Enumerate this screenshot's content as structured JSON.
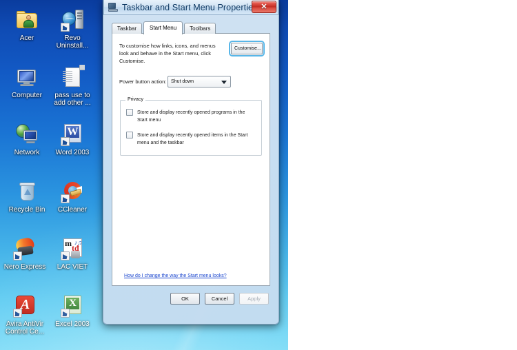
{
  "window": {
    "title": "Taskbar and Start Menu Properties",
    "title_icon": "taskbar-icon",
    "close_label": "✕"
  },
  "tabs": [
    {
      "label": "Taskbar",
      "active": false
    },
    {
      "label": "Start Menu",
      "active": true
    },
    {
      "label": "Toolbars",
      "active": false
    }
  ],
  "start_menu_tab": {
    "description": "To customise how links, icons, and menus look and behave in the Start menu, click Customise.",
    "customise_button": "Customise...",
    "power_button_label": "Power button action:",
    "power_button_value": "Shut down",
    "power_button_options": [
      "Shut down"
    ],
    "privacy": {
      "legend": "Privacy",
      "checkboxes": [
        {
          "label": "Store and display recently opened programs in the Start menu",
          "checked": false
        },
        {
          "label": "Store and display recently opened items in the Start menu and the taskbar",
          "checked": false
        }
      ]
    },
    "help_link": "How do I change the way the Start menu looks?"
  },
  "buttons": {
    "ok": "OK",
    "cancel": "Cancel",
    "apply": "Apply",
    "apply_disabled": true
  },
  "desktop": {
    "icons": [
      {
        "label": "Acer",
        "icon": "folder-user-icon",
        "shortcut": false
      },
      {
        "label": "Revo Uninstall...",
        "icon": "revo-uninstaller-icon",
        "shortcut": true
      },
      {
        "label": "Computer",
        "icon": "computer-icon",
        "shortcut": false
      },
      {
        "label": "pass use to add other ...",
        "icon": "text-document-icon",
        "shortcut": false
      },
      {
        "label": "Network",
        "icon": "network-icon",
        "shortcut": false
      },
      {
        "label": "Word 2003",
        "icon": "microsoft-word-icon",
        "shortcut": true
      },
      {
        "label": "Recycle Bin",
        "icon": "recycle-bin-icon",
        "shortcut": false
      },
      {
        "label": "CCleaner",
        "icon": "ccleaner-icon",
        "shortcut": true
      },
      {
        "label": "Nero Express",
        "icon": "nero-express-icon",
        "shortcut": true
      },
      {
        "label": "LAC VIET",
        "icon": "lac-viet-icon",
        "shortcut": true
      },
      {
        "label": "Avira AntiVir Control Ce...",
        "icon": "avira-antivir-icon",
        "shortcut": true
      },
      {
        "label": "Excel 2003",
        "icon": "microsoft-excel-icon",
        "shortcut": true
      }
    ]
  },
  "colors": {
    "desktop_top": "#0a3c9e",
    "desktop_bottom": "#7fdcf7",
    "close_button": "#c02a20",
    "link": "#1c48cf",
    "focus_ring": "#58b6e8"
  }
}
